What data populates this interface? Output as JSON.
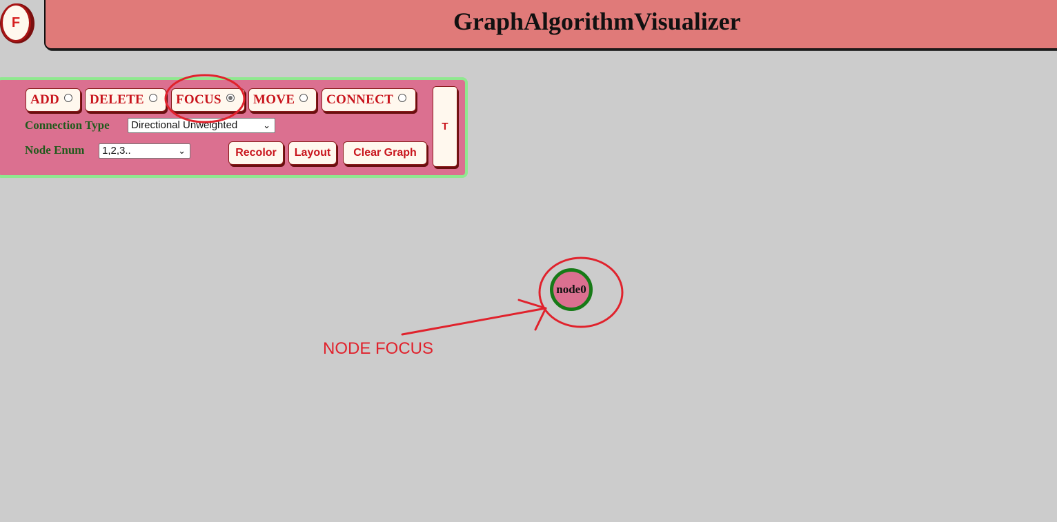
{
  "logo": {
    "label": "F"
  },
  "header": {
    "title": "GraphAlgorithmVisualizer"
  },
  "panel": {
    "modes": [
      {
        "label": "ADD",
        "checked": false
      },
      {
        "label": "DELETE",
        "checked": false
      },
      {
        "label": "FOCUS",
        "checked": true
      },
      {
        "label": "MOVE",
        "checked": false
      },
      {
        "label": "CONNECT",
        "checked": false
      }
    ],
    "connection_type": {
      "label": "Connection Type",
      "value": "Directional Unweighted"
    },
    "node_enum": {
      "label": "Node Enum",
      "value": "1,2,3.."
    },
    "buttons": {
      "recolor": "Recolor",
      "layout": "Layout",
      "clear_graph": "Clear Graph"
    },
    "toggle_label": "T"
  },
  "graph": {
    "nodes": [
      {
        "label": "node0"
      }
    ]
  },
  "annotation": {
    "text": "NODE FOCUS",
    "color": "#e0222c"
  },
  "colors": {
    "background": "#cccccc",
    "title_bar": "#e07a79",
    "panel": "#db7090",
    "panel_border": "#8fe88f",
    "button_text": "#c8141c",
    "label_text": "#205a1c",
    "node_border": "#177a17"
  }
}
